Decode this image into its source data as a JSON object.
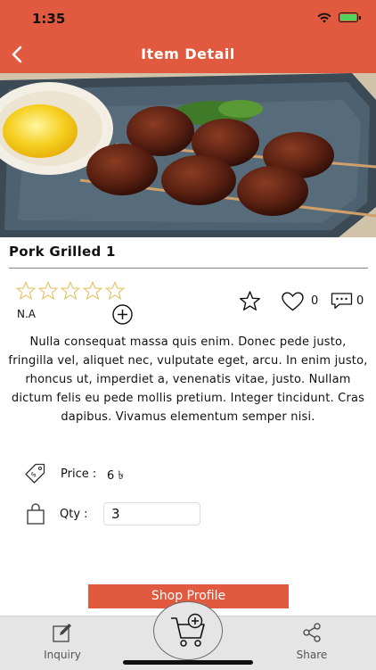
{
  "status_bar": {
    "time": "1:35"
  },
  "header": {
    "title": "Item Detail",
    "back_icon": "chevron-left-icon"
  },
  "hero": {
    "image_description": "grilled pork meatballs on skewers with a raw egg yolk"
  },
  "item": {
    "name": "Pork Grilled 1",
    "rating_stars": 0,
    "rating_max": 5,
    "rating_label": "N.A",
    "like_count": "0",
    "comment_count": "0",
    "description": "Nulla consequat massa quis enim. Donec pede justo, fringilla vel, aliquet nec, vulputate eget, arcu. In enim justo, rhoncus ut, imperdiet a, venenatis vitae, justo. Nullam dictum felis eu pede mollis pretium. Integer tincidunt.  Cras dapibus. Vivamus elementum semper nisi.",
    "price_label": "Price :",
    "price_value": "6 ৳",
    "qty_label": "Qty :",
    "qty_value": "3"
  },
  "actions": {
    "shop_profile_label": "Shop Profile"
  },
  "tabbar": {
    "inquiry_label": "Inquiry",
    "share_label": "Share"
  },
  "colors": {
    "accent": "#e15a3f",
    "tabbar_bg": "#e5e5e5"
  }
}
